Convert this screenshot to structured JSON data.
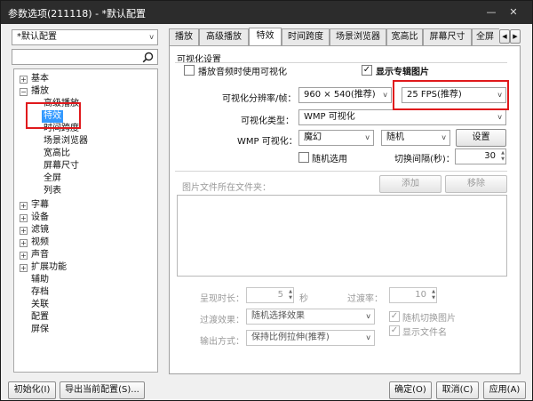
{
  "window": {
    "title": "参数选项(211118) - *默认配置",
    "minimize": "—",
    "close": "✕"
  },
  "sidebar": {
    "profile": "*默认配置",
    "search_placeholder": "",
    "tree": [
      {
        "label": "基本",
        "toggle": "+"
      },
      {
        "label": "播放",
        "toggle": "−"
      },
      {
        "label": "高级播放"
      },
      {
        "label": "特效"
      },
      {
        "label": "时间跨度"
      },
      {
        "label": "场景浏览器"
      },
      {
        "label": "宽高比"
      },
      {
        "label": "屏幕尺寸"
      },
      {
        "label": "全屏"
      },
      {
        "label": "列表"
      },
      {
        "label": "字幕",
        "toggle": "+"
      },
      {
        "label": "设备",
        "toggle": "+"
      },
      {
        "label": "滤镜",
        "toggle": "+"
      },
      {
        "label": "视频",
        "toggle": "+"
      },
      {
        "label": "声音",
        "toggle": "+"
      },
      {
        "label": "扩展功能",
        "toggle": "+"
      },
      {
        "label": "辅助"
      },
      {
        "label": "存档"
      },
      {
        "label": "关联"
      },
      {
        "label": "配置"
      },
      {
        "label": "屏保"
      }
    ]
  },
  "tabs": [
    "播放",
    "高级播放",
    "特效",
    "时间跨度",
    "场景浏览器",
    "宽高比",
    "屏幕尺寸",
    "全屏"
  ],
  "tab_nav": {
    "prev": "◀",
    "next": "▶"
  },
  "panel": {
    "group_title": "可视化设置",
    "viz_on_audio": "播放音频时使用可视化",
    "show_album_art": "显示专辑图片",
    "resolution_label": "可视化分辨率/帧：",
    "resolution_value": "960 × 540(推荐)",
    "fps_value": "25 FPS(推荐)",
    "viz_type_label": "可视化类型：",
    "viz_type_value": "WMP 可视化",
    "wmp_label": "WMP 可视化：",
    "wmp_effect": "魔幻",
    "wmp_mode": "随机",
    "settings_btn": "设置",
    "random_select": "随机选用",
    "switch_interval_label": "切换间隔(秒)：",
    "switch_interval_value": "30",
    "image_folder_label": "图片文件所在文件夹：",
    "add_btn": "添加",
    "remove_btn": "移除",
    "duration_label": "呈现时长：",
    "duration_value": "5",
    "duration_unit": "秒",
    "transition_rate_label": "过渡率：",
    "transition_rate_value": "10",
    "transition_effect_label": "过渡效果：",
    "transition_effect_value": "随机选择效果",
    "random_switch_image": "随机切换图片",
    "output_mode_label": "输出方式：",
    "output_mode_value": "保持比例拉伸(推荐)",
    "show_filename": "显示文件名"
  },
  "footer": {
    "init_btn": "初始化(I)",
    "export_btn": "导出当前配置(S)...",
    "ok_btn": "确定(O)",
    "cancel_btn": "取消(C)",
    "apply_btn": "应用(A)"
  },
  "colors": {
    "highlight": "#e0191c",
    "selection": "#3399ff",
    "titlebar": "#2c2c2c"
  }
}
